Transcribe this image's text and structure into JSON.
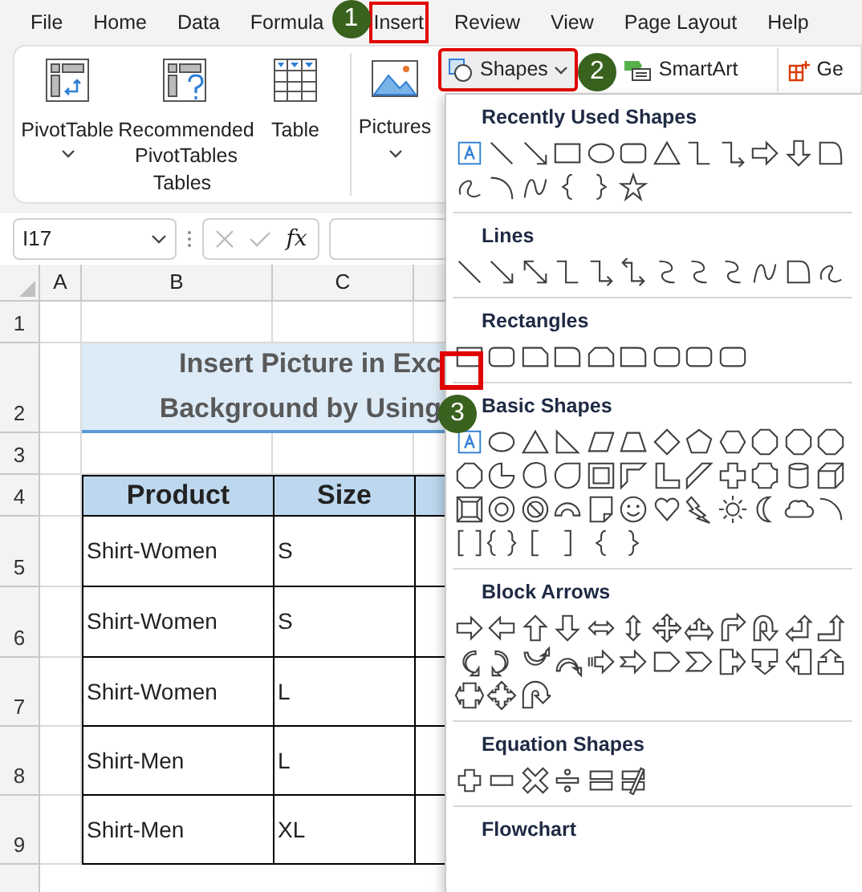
{
  "menu_tabs": [
    {
      "label": "File",
      "highlighted": false
    },
    {
      "label": "Home",
      "highlighted": false
    },
    {
      "label": "Data",
      "highlighted": false
    },
    {
      "label": "Formula",
      "highlighted": false
    },
    {
      "label": "Insert",
      "highlighted": true
    },
    {
      "label": "Review",
      "highlighted": false
    },
    {
      "label": "View",
      "highlighted": false
    },
    {
      "label": "Page Layout",
      "highlighted": false
    },
    {
      "label": "Help",
      "highlighted": false
    }
  ],
  "ribbon": {
    "tables": [
      {
        "label": "PivotTable",
        "dropdown": true
      },
      {
        "label": "Recommended PivotTables",
        "dropdown": false
      },
      {
        "label": "Table",
        "dropdown": false
      }
    ],
    "group_label": "Tables",
    "pictures": {
      "label": "Pictures",
      "dropdown": true
    },
    "shapes": {
      "label": "Shapes",
      "highlighted": true
    },
    "smartart": {
      "label": "SmartArt"
    },
    "addins": {
      "label": "Ge"
    }
  },
  "formula_bar": {
    "name_box": "I17",
    "fx": "fx"
  },
  "sheet": {
    "columns": [
      "A",
      "B",
      "C"
    ],
    "row_numbers": [
      "1",
      "2",
      "3",
      "4",
      "5",
      "6",
      "7",
      "8",
      "9"
    ],
    "title_lines": [
      "Insert Picture in Exc",
      "Background by Using"
    ],
    "table": {
      "columns": [
        "Product",
        "Size"
      ],
      "rows": [
        [
          "Shirt-Women",
          "S"
        ],
        [
          "Shirt-Women",
          "S"
        ],
        [
          "Shirt-Women",
          "L"
        ],
        [
          "Shirt-Men",
          "L"
        ],
        [
          "Shirt-Men",
          "XL"
        ]
      ]
    }
  },
  "shapes_menu": {
    "sections": [
      {
        "title": "Recently Used Shapes"
      },
      {
        "title": "Lines"
      },
      {
        "title": "Rectangles"
      },
      {
        "title": "Basic Shapes"
      },
      {
        "title": "Block Arrows"
      },
      {
        "title": "Equation Shapes"
      },
      {
        "title": "Flowchart"
      }
    ]
  },
  "callouts": [
    {
      "label": "1"
    },
    {
      "label": "2"
    },
    {
      "label": "3"
    }
  ]
}
